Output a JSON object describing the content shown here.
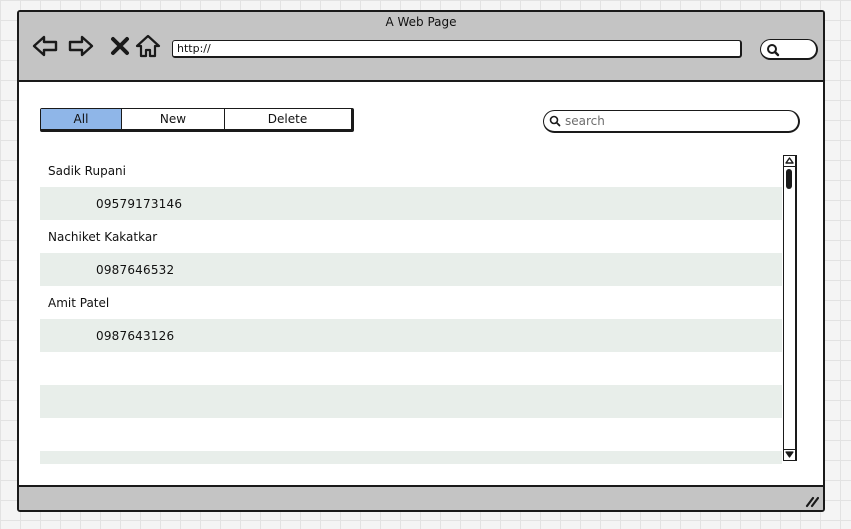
{
  "window": {
    "title": "A Web Page"
  },
  "address_bar": {
    "url": "http://"
  },
  "toolbar": {
    "back_icon": "back-arrow-icon",
    "forward_icon": "forward-arrow-icon",
    "stop_icon": "close-icon",
    "home_icon": "home-icon",
    "search_icon": "search-icon"
  },
  "tabs": [
    {
      "label": "All",
      "active": true
    },
    {
      "label": "New",
      "active": false
    },
    {
      "label": "Delete",
      "active": false
    }
  ],
  "search": {
    "placeholder": "search"
  },
  "contacts": [
    {
      "name": "Sadik Rupani",
      "phone": "09579173146"
    },
    {
      "name": "Nachiket Kakatkar",
      "phone": "0987646532"
    },
    {
      "name": "Amit Patel",
      "phone": "0987643126"
    }
  ],
  "colors": {
    "active_tab": "#8fb6e8",
    "row_stripe": "#e8eeea",
    "chrome": "#c4c4c4",
    "border": "#1a1a1a"
  }
}
